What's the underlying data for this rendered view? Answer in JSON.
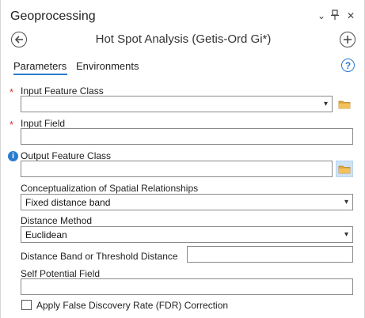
{
  "pane": {
    "title": "Geoprocessing",
    "controls": {
      "menu": "⌄",
      "pin": "⊥",
      "close": "✕"
    }
  },
  "tool": {
    "title": "Hot Spot Analysis (Getis-Ord Gi*)",
    "back_icon": "back-arrow-icon",
    "add_icon": "add-icon"
  },
  "tabs": [
    {
      "label": "Parameters",
      "active": true
    },
    {
      "label": "Environments",
      "active": false
    }
  ],
  "help_label": "?",
  "required_marker": "*",
  "info_marker": "i",
  "fields": {
    "input_feature_class": {
      "label": "Input Feature Class",
      "value": ""
    },
    "input_field": {
      "label": "Input Field",
      "value": ""
    },
    "output_feature_class": {
      "label": "Output Feature Class",
      "value": ""
    },
    "conceptualization": {
      "label": "Conceptualization of Spatial Relationships",
      "value": "Fixed distance band"
    },
    "distance_method": {
      "label": "Distance Method",
      "value": "Euclidean"
    },
    "distance_band": {
      "label": "Distance Band or Threshold Distance",
      "value": ""
    },
    "self_potential": {
      "label": "Self Potential Field",
      "value": ""
    },
    "fdr": {
      "label": "Apply False Discovery Rate (FDR) Correction",
      "checked": false
    }
  },
  "colors": {
    "accent": "#2a7bd0",
    "required": "#d9352b",
    "folder": "#e2a93b",
    "active_button_bg": "#cfe3f6"
  }
}
